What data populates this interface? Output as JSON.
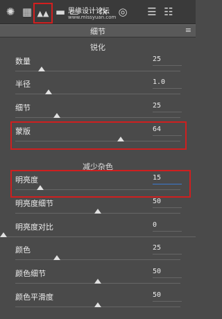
{
  "toolbar": {
    "icons": [
      {
        "name": "aperture-icon",
        "glyph": "✺"
      },
      {
        "name": "grid-icon",
        "glyph": "▦"
      },
      {
        "name": "detail-mountains-icon",
        "glyph": "▲▲"
      },
      {
        "name": "split-toning-icon",
        "glyph": "▬"
      },
      {
        "name": "lens-icon",
        "glyph": "▭"
      },
      {
        "name": "fx-icon",
        "glyph": "fx"
      },
      {
        "name": "camera-icon",
        "glyph": "◎"
      },
      {
        "name": "sliders-icon",
        "glyph": "☰"
      },
      {
        "name": "presets-icon",
        "glyph": "☷"
      }
    ],
    "watermark": "思缘设计论坛",
    "watermark_sub": "www.missyuan.com"
  },
  "panel": {
    "title": "细节",
    "menu_glyph": "≡"
  },
  "sharpening": {
    "title": "锐化",
    "rows": [
      {
        "label": "数量",
        "value": "25",
        "level": 0.16
      },
      {
        "label": "半径",
        "value": "1.0",
        "level": 0.2
      },
      {
        "label": "细节",
        "value": "25",
        "level": 0.25
      },
      {
        "label": "蒙版",
        "value": "64",
        "level": 0.64
      }
    ]
  },
  "noise": {
    "title": "减少杂色",
    "rows": [
      {
        "label": "明亮度",
        "value": "15",
        "level": 0.15,
        "focused": true
      },
      {
        "label": "明亮度细节",
        "value": "50",
        "level": 0.5
      },
      {
        "label": "明亮度对比",
        "value": "0",
        "level": 0.0
      },
      {
        "label": "颜色",
        "value": "25",
        "level": 0.25
      },
      {
        "label": "颜色细节",
        "value": "50",
        "level": 0.5
      },
      {
        "label": "颜色平滑度",
        "value": "50",
        "level": 0.5
      }
    ]
  },
  "colors": {
    "highlight": "#cf1f1f",
    "focus": "#3b7ad0"
  }
}
